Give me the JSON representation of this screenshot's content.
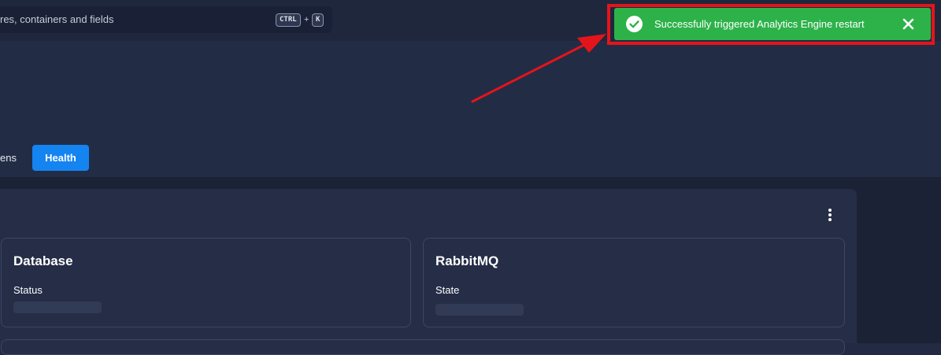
{
  "search": {
    "placeholder_visible": "res, containers and fields",
    "shortcut_ctrl": "CTRL",
    "shortcut_plus": "+",
    "shortcut_key": "K"
  },
  "tabs": {
    "partial_label": "ens",
    "active_label": "Health"
  },
  "cards": [
    {
      "title": "Database",
      "label": "Status"
    },
    {
      "title": "RabbitMQ",
      "label": "State"
    }
  ],
  "toast": {
    "message": "Successfully triggered Analytics Engine restart",
    "icon": "check-circle-icon",
    "close_icon": "close-icon",
    "color": "#2db24a",
    "highlight_color": "#e5141b"
  },
  "colors": {
    "accent": "#1484f1",
    "background": "#222b43"
  }
}
